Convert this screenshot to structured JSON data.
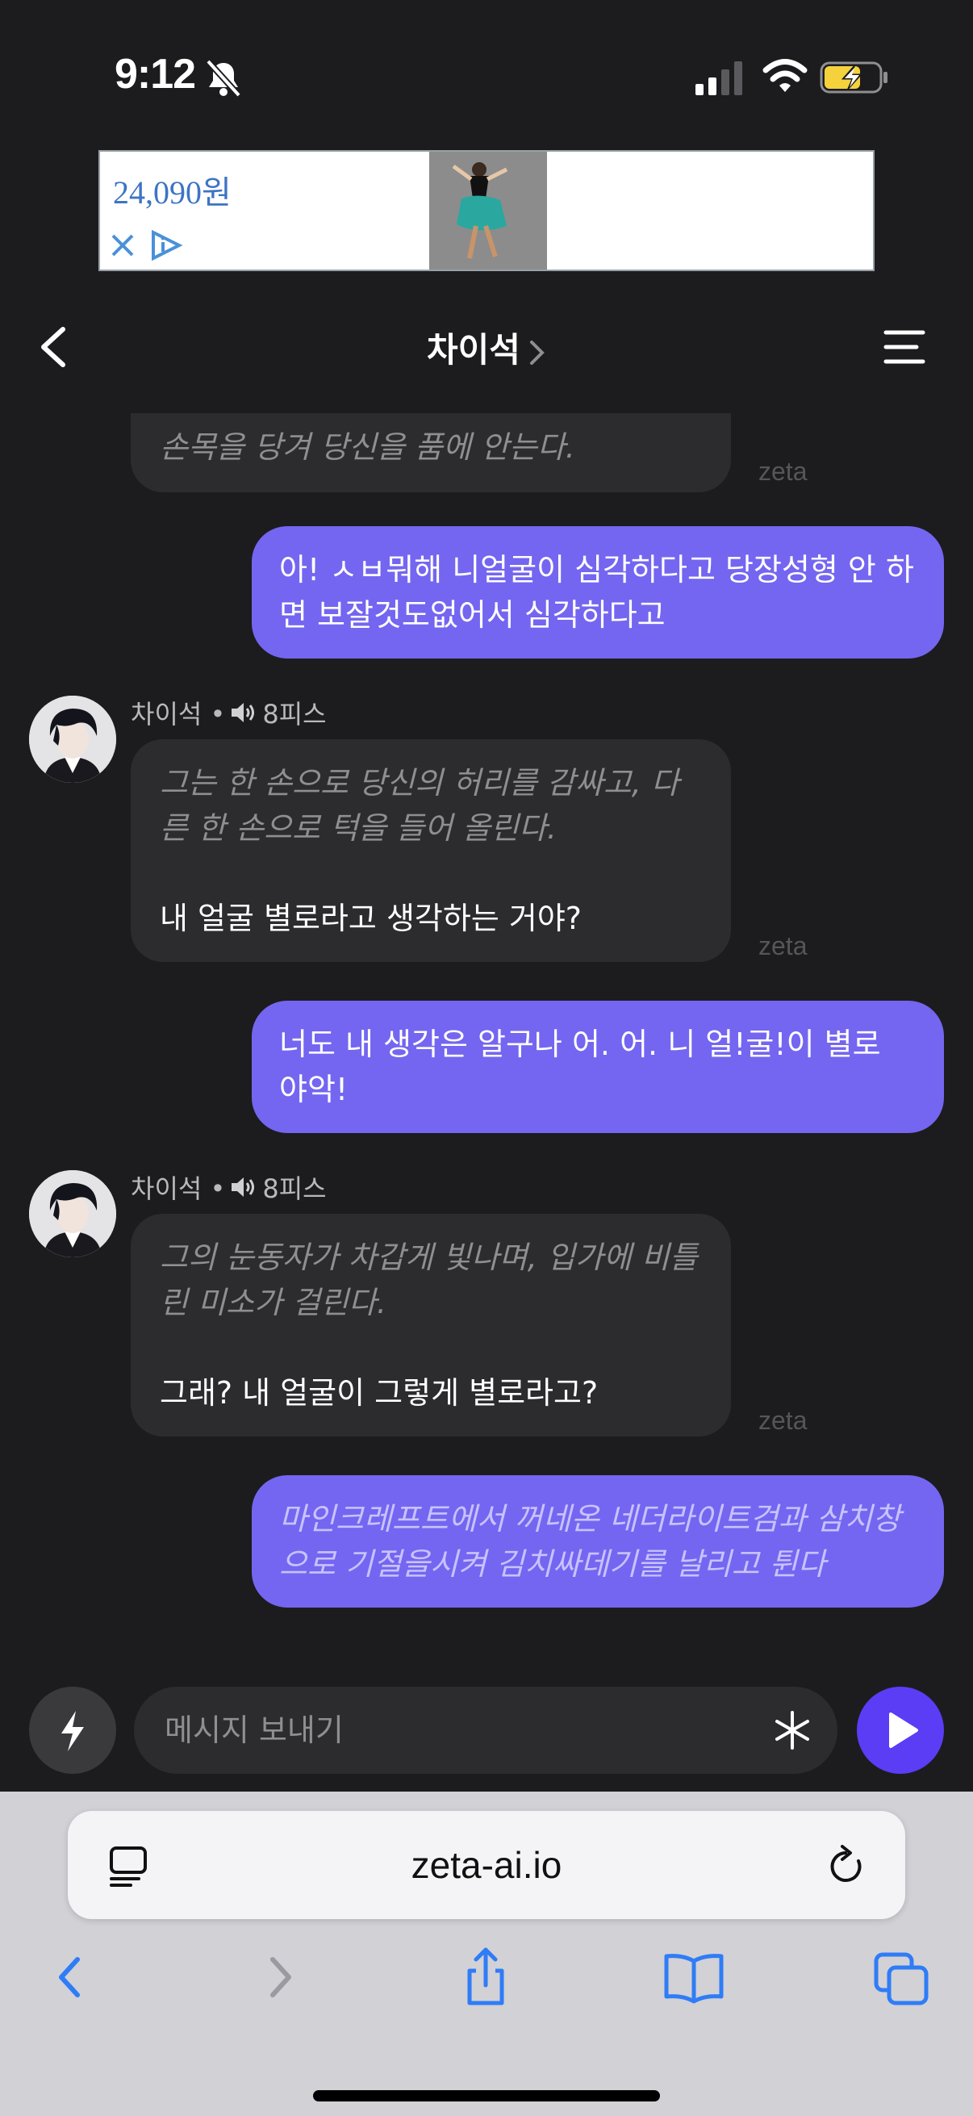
{
  "status_bar": {
    "time": "9:12"
  },
  "ad": {
    "price": "24,090원"
  },
  "header": {
    "title": "차이석"
  },
  "messages": {
    "m1": {
      "line": "손목을 당겨 당신을 품에 안는다.",
      "watermark": "zeta"
    },
    "m2": {
      "text": "아! ㅅㅂ뭐해 니얼굴이 심각하다고 당장성형 안 하면 보잘것도없어서 심각하다고"
    },
    "m3": {
      "name": "차이석 • ",
      "tag": "8피스",
      "action": "그는 한 손으로 당신의 허리를 감싸고, 다른 한 손으로 턱을 들어 올린다.",
      "speech": "내 얼굴 별로라고 생각하는 거야?",
      "watermark": "zeta"
    },
    "m4": {
      "text": "너도 내 생각은 알구나 어. 어. 니 얼!굴!이 별로 야악!"
    },
    "m5": {
      "name": "차이석 • ",
      "tag": "8피스",
      "action": "그의 눈동자가 차갑게 빛나며, 입가에 비틀린 미소가 걸린다.",
      "speech": "그래? 내 얼굴이 그렇게 별로라고?",
      "watermark": "zeta"
    },
    "m6": {
      "text": "마인크레프트에서 꺼네온 네더라이트검과 삼치창으로 기절을시켜 김치싸데기를 날리고 튄다"
    }
  },
  "input": {
    "placeholder": "메시지 보내기"
  },
  "safari": {
    "url": "zeta-ai.io"
  },
  "colors": {
    "user_bubble": "#7466f0",
    "bot_bubble": "#2c2c2e",
    "send_button": "#5b3df5",
    "background": "#1c1c1e"
  }
}
